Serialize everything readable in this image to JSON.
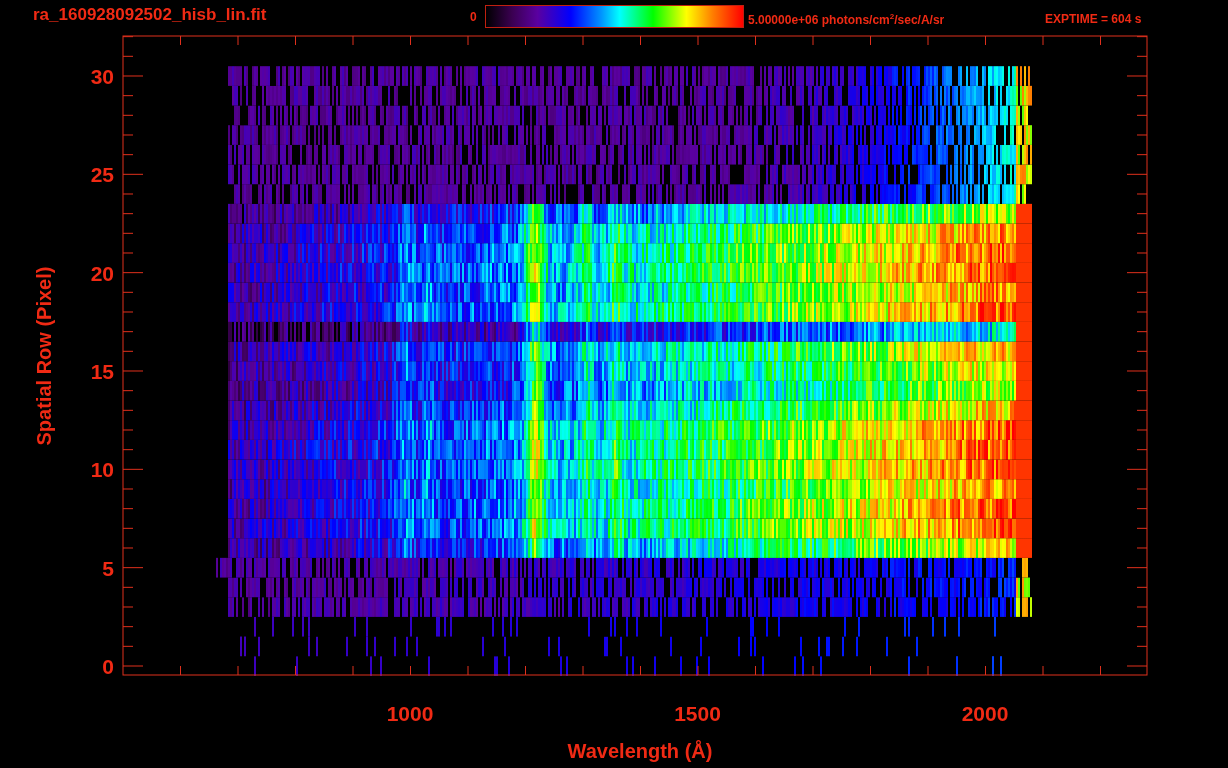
{
  "title": "ra_160928092502_hisb_lin.fit",
  "colorbar": {
    "min_label": "0",
    "max_label": "5.00000e+06 photons/cm$^{2}$/sec/A/sr"
  },
  "exposure": "EXPTIME = 604 s",
  "plot": {
    "x_axis": {
      "title": "Wavelength (Å)",
      "tick_labels": [
        "1000",
        "1500",
        "2000"
      ]
    },
    "y_axis": {
      "title": "Spatial Row (Pixel)",
      "tick_labels": [
        "30",
        "25",
        "20",
        "15",
        "10",
        "5",
        "0"
      ]
    }
  }
}
